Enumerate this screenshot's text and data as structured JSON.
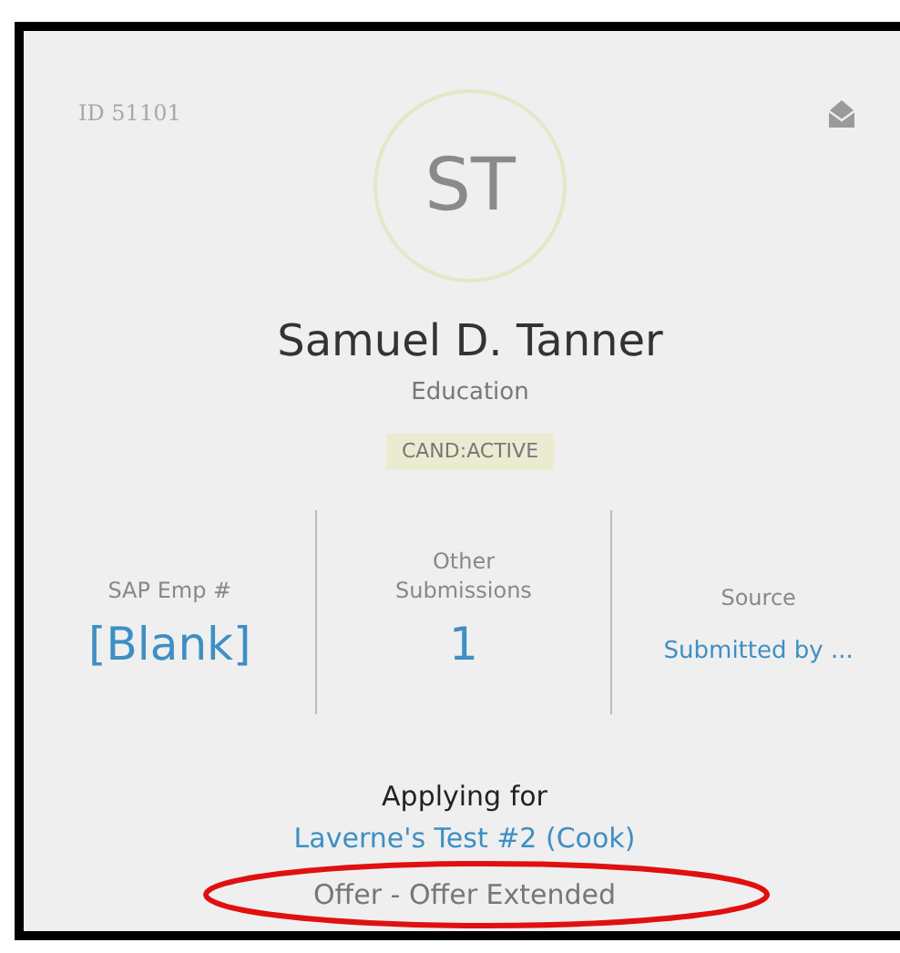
{
  "card": {
    "id_label": "ID 51101",
    "initials": "ST",
    "name": "Samuel D. Tanner",
    "department": "Education",
    "status_badge": "CAND:ACTIVE",
    "stats": [
      {
        "label": "SAP Emp #",
        "value": "[Blank]",
        "kind": "large"
      },
      {
        "label": "Other Submissions",
        "value": "1",
        "kind": "large"
      },
      {
        "label": "Source",
        "value": "Submitted by ...",
        "kind": "small"
      }
    ],
    "applying_label": "Applying for",
    "job_link": "Laverne's Test #2 (Cook)",
    "offer_status": "Offer - Offer Extended"
  },
  "annotation": {
    "kind": "ellipse",
    "color": "#e01010"
  }
}
